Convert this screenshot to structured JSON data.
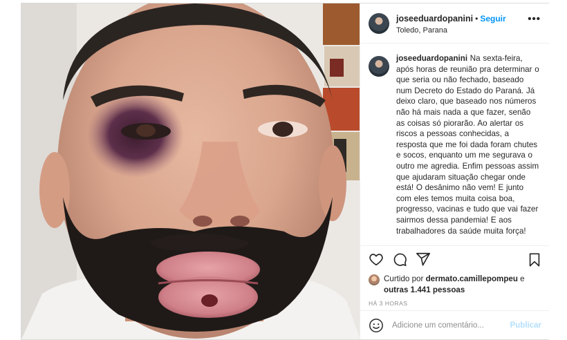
{
  "post": {
    "author": {
      "username": "joseeduardopanini",
      "follow_label": "Seguir",
      "separator": "•",
      "location": "Toledo, Parana"
    },
    "more_icon": "more-options-icon",
    "caption": {
      "username": "joseeduardopanini",
      "text": " Na sexta-feira, após horas de reunião pra determinar o que seria ou não fechado, baseado num Decreto do Estado do Paraná. Já deixo claro, que baseado nos números não há mais nada a que fazer, senão as coisas só piorarão. Ao alertar os riscos a pessoas conhecidas, a resposta que me foi dada foram chutes e socos, enquanto um me segurava o outro me agredia. Enfim pessoas assim que ajudaram situação chegar onde está! O desânimo não vem! E junto com eles temos muita coisa boa, progresso, vacinas e tudo que vai fazer sairmos dessa pandemia! E aos trabalhadores da saúde muita força!"
    },
    "actions": {
      "like_icon": "heart-icon",
      "comment_icon": "comment-icon",
      "share_icon": "share-icon",
      "save_icon": "bookmark-icon"
    },
    "likes": {
      "prefix": "Curtido por ",
      "first_user": "dermato.camillepompeu",
      "connector": " e ",
      "others": "outras 1.441 pessoas"
    },
    "timestamp": "HÁ 3 HORAS",
    "comment": {
      "emoji_icon": "emoji-icon",
      "placeholder": "Adicione um comentário...",
      "publish_label": "Publicar"
    }
  },
  "colors": {
    "link_blue": "#0095f6",
    "publish_disabled": "#b2dffc",
    "text": "#262626",
    "muted": "#8e8e8e",
    "border": "#dbdbdb"
  }
}
